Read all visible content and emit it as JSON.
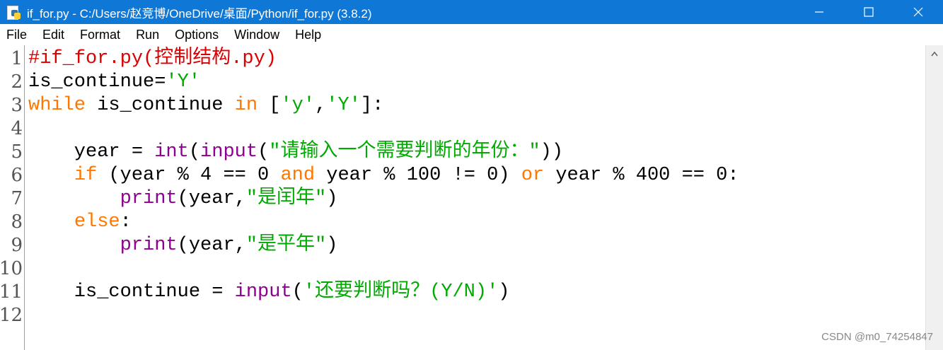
{
  "window": {
    "title": "if_for.py - C:/Users/赵竞博/OneDrive/桌面/Python/if_for.py (3.8.2)",
    "app_icon": "python-file-icon",
    "controls": [
      "minimize-icon",
      "maximize-icon",
      "close-icon"
    ]
  },
  "menu": {
    "items": [
      "File",
      "Edit",
      "Format",
      "Run",
      "Options",
      "Window",
      "Help"
    ]
  },
  "colors": {
    "titlebar": "#0f78d7",
    "comment": "#dd0000",
    "string": "#00aa00",
    "keyword": "#ff7700",
    "builtin": "#900090",
    "default": "#000000"
  },
  "editor": {
    "line_numbers": [
      "1",
      "2",
      "3",
      "4",
      "5",
      "6",
      "7",
      "8",
      "9",
      "10",
      "11",
      "12"
    ],
    "lines": [
      [
        {
          "t": "#if_for.py(控制结构.py)",
          "c": "comment"
        }
      ],
      [
        {
          "t": "is_continue=",
          "c": "default"
        },
        {
          "t": "'Y'",
          "c": "string"
        }
      ],
      [
        {
          "t": "while",
          "c": "keyword"
        },
        {
          "t": " is_continue ",
          "c": "default"
        },
        {
          "t": "in",
          "c": "keyword"
        },
        {
          "t": " [",
          "c": "default"
        },
        {
          "t": "'y'",
          "c": "string"
        },
        {
          "t": ",",
          "c": "default"
        },
        {
          "t": "'Y'",
          "c": "string"
        },
        {
          "t": "]:",
          "c": "default"
        }
      ],
      [],
      [
        {
          "t": "    year = ",
          "c": "default"
        },
        {
          "t": "int",
          "c": "builtin"
        },
        {
          "t": "(",
          "c": "default"
        },
        {
          "t": "input",
          "c": "builtin"
        },
        {
          "t": "(",
          "c": "default"
        },
        {
          "t": "\"请输入一个需要判断的年份：\"",
          "c": "string"
        },
        {
          "t": "))",
          "c": "default"
        }
      ],
      [
        {
          "t": "    ",
          "c": "default"
        },
        {
          "t": "if",
          "c": "keyword"
        },
        {
          "t": " (year % 4 == 0 ",
          "c": "default"
        },
        {
          "t": "and",
          "c": "keyword"
        },
        {
          "t": " year % 100 != 0) ",
          "c": "default"
        },
        {
          "t": "or",
          "c": "keyword"
        },
        {
          "t": " year % 400 == 0:",
          "c": "default"
        }
      ],
      [
        {
          "t": "        ",
          "c": "default"
        },
        {
          "t": "print",
          "c": "builtin"
        },
        {
          "t": "(year,",
          "c": "default"
        },
        {
          "t": "\"是闰年\"",
          "c": "string"
        },
        {
          "t": ")",
          "c": "default"
        }
      ],
      [
        {
          "t": "    ",
          "c": "default"
        },
        {
          "t": "else",
          "c": "keyword"
        },
        {
          "t": ":",
          "c": "default"
        }
      ],
      [
        {
          "t": "        ",
          "c": "default"
        },
        {
          "t": "print",
          "c": "builtin"
        },
        {
          "t": "(year,",
          "c": "default"
        },
        {
          "t": "\"是平年\"",
          "c": "string"
        },
        {
          "t": ")",
          "c": "default"
        }
      ],
      [],
      [
        {
          "t": "    is_continue = ",
          "c": "default"
        },
        {
          "t": "input",
          "c": "builtin"
        },
        {
          "t": "(",
          "c": "default"
        },
        {
          "t": "'还要判断吗？(Y/N)'",
          "c": "string"
        },
        {
          "t": ")",
          "c": "default"
        }
      ],
      []
    ]
  },
  "watermark": "CSDN @m0_74254847"
}
